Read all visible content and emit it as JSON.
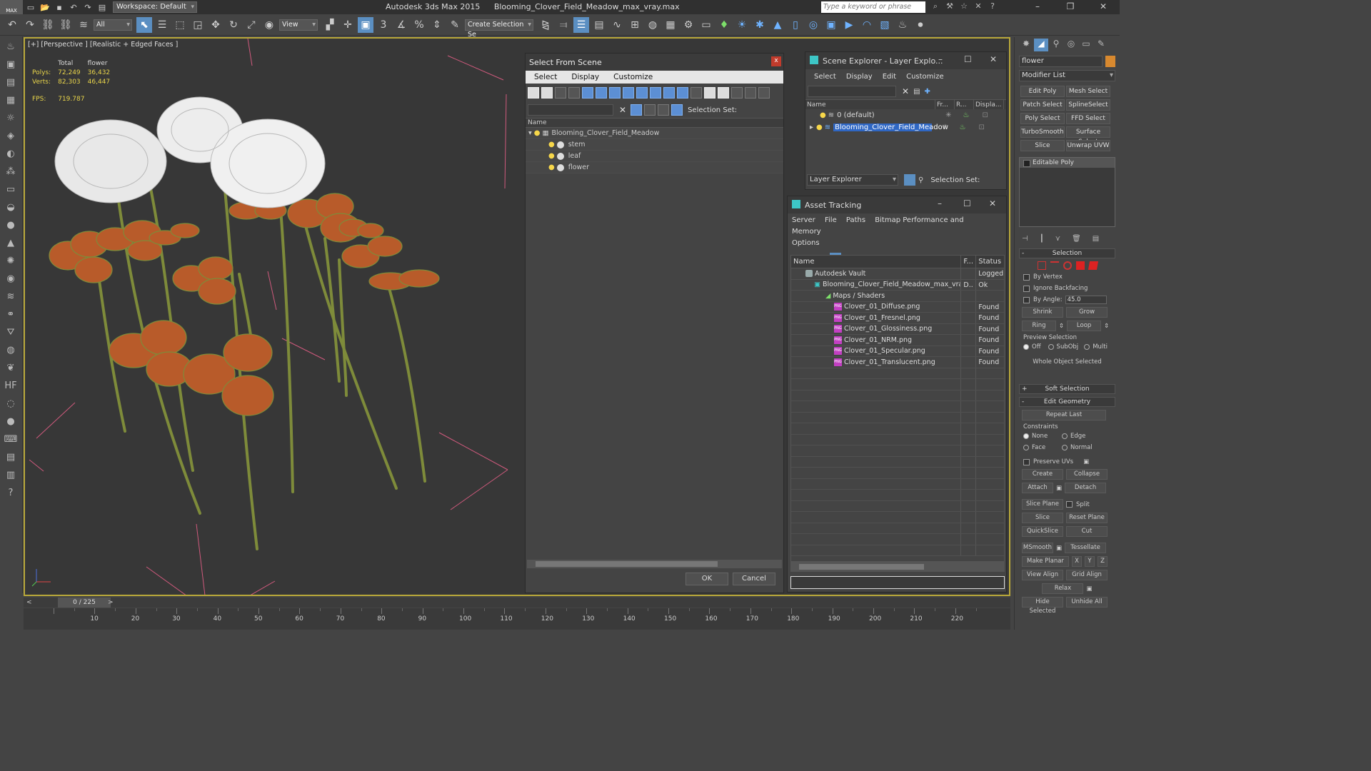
{
  "app": {
    "logo": "MAX",
    "title": "Autodesk 3ds Max  2015",
    "filename": "Blooming_Clover_Field_Meadow_max_vray.max",
    "workspace": "Workspace: Default",
    "search_placeholder": "Type a keyword or phrase"
  },
  "toolbar": {
    "filter_dropdown": "All",
    "refcoord_dropdown": "View",
    "selection_set": "Create Selection Se"
  },
  "viewport": {
    "label": "[+] [Perspective ] [Realistic + Edged Faces ]",
    "stats": {
      "col_total": "Total",
      "col_object": "flower",
      "polys_label": "Polys:",
      "polys_total": "72,249",
      "polys_object": "36,432",
      "verts_label": "Verts:",
      "verts_total": "82,303",
      "verts_object": "46,447",
      "fps_label": "FPS:",
      "fps_value": "719.787"
    }
  },
  "select_from_scene": {
    "title": "Select From Scene",
    "menu": [
      "Select",
      "Display",
      "Customize"
    ],
    "selection_set_label": "Selection Set:",
    "col_name": "Name",
    "root": "Blooming_Clover_Field_Meadow",
    "children": [
      "stem",
      "leaf",
      "flower"
    ],
    "ok": "OK",
    "cancel": "Cancel"
  },
  "scene_explorer": {
    "title": "Scene Explorer - Layer Explo...",
    "menu": [
      "Select",
      "Display",
      "Edit",
      "Customize"
    ],
    "cols": [
      "Name",
      "Fr...",
      "R...",
      "Displa..."
    ],
    "rows": [
      "0 (default)",
      "Blooming_Clover_Field_Meadow"
    ],
    "footer_dropdown": "Layer Explorer",
    "selection_set_label": "Selection Set:"
  },
  "asset_tracking": {
    "title": "Asset Tracking",
    "menu": [
      "Server",
      "File",
      "Paths",
      "Bitmap Performance and Memory",
      "Options"
    ],
    "cols": [
      "Name",
      "F...",
      "Status"
    ],
    "rows": [
      {
        "name": "Autodesk Vault",
        "f": "",
        "status": "Logged"
      },
      {
        "name": "Blooming_Clover_Field_Meadow_max_vra...",
        "f": "D..",
        "status": "Ok"
      },
      {
        "name": "Maps / Shaders",
        "f": "",
        "status": ""
      },
      {
        "name": "Clover_01_Diffuse.png",
        "f": "",
        "status": "Found"
      },
      {
        "name": "Clover_01_Fresnel.png",
        "f": "",
        "status": "Found"
      },
      {
        "name": "Clover_01_Glossiness.png",
        "f": "",
        "status": "Found"
      },
      {
        "name": "Clover_01_NRM.png",
        "f": "",
        "status": "Found"
      },
      {
        "name": "Clover_01_Specular.png",
        "f": "",
        "status": "Found"
      },
      {
        "name": "Clover_01_Translucent.png",
        "f": "",
        "status": "Found"
      }
    ]
  },
  "command_panel": {
    "object_name": "flower",
    "modifier_list": "Modifier List",
    "modifier_buttons": [
      "Edit Poly",
      "Mesh Select",
      "Patch Select",
      "SplineSelect",
      "Poly Select",
      "FFD Select",
      "TurboSmooth",
      "Surface Select",
      "Slice",
      "Unwrap UVW"
    ],
    "stack_item": "Editable Poly",
    "selection": {
      "title": "Selection",
      "by_vertex": "By Vertex",
      "ignore_backfacing": "Ignore Backfacing",
      "by_angle": "By Angle:",
      "angle_value": "45.0",
      "shrink": "Shrink",
      "grow": "Grow",
      "ring": "Ring",
      "loop": "Loop",
      "preview_label": "Preview Selection",
      "preview_off": "Off",
      "preview_subobj": "SubObj",
      "preview_multi": "Multi",
      "whole_object": "Whole Object Selected"
    },
    "soft_selection": "Soft Selection",
    "edit_geometry": {
      "title": "Edit Geometry",
      "repeat_last": "Repeat Last",
      "constraints": "Constraints",
      "none": "None",
      "edge": "Edge",
      "face": "Face",
      "normal": "Normal",
      "preserve_uvs": "Preserve UVs",
      "create": "Create",
      "collapse": "Collapse",
      "attach": "Attach",
      "detach": "Detach",
      "slice_plane": "Slice Plane",
      "split": "Split",
      "slice": "Slice",
      "reset_plane": "Reset Plane",
      "quickslice": "QuickSlice",
      "cut": "Cut",
      "msmooth": "MSmooth",
      "tessellate": "Tessellate",
      "make_planar": "Make Planar",
      "x": "X",
      "y": "Y",
      "z": "Z",
      "view_align": "View Align",
      "grid_align": "Grid Align",
      "relax": "Relax",
      "hide_selected": "Hide Selected",
      "unhide_all": "Unhide All"
    }
  },
  "timeline": {
    "frame_counter": "0 / 225",
    "ticks": [
      "10",
      "20",
      "30",
      "40",
      "50",
      "60",
      "70",
      "80",
      "90",
      "100",
      "110",
      "120",
      "130",
      "140",
      "150",
      "160",
      "170",
      "180",
      "190",
      "200",
      "210",
      "220"
    ]
  },
  "colors": {
    "viewport_border": "#b9a83a",
    "selection_blue": "#2f67c4",
    "stats_yellow": "#e8d44a",
    "leaf_orange": "#c9652c",
    "stem_green": "#7e8b3a"
  }
}
